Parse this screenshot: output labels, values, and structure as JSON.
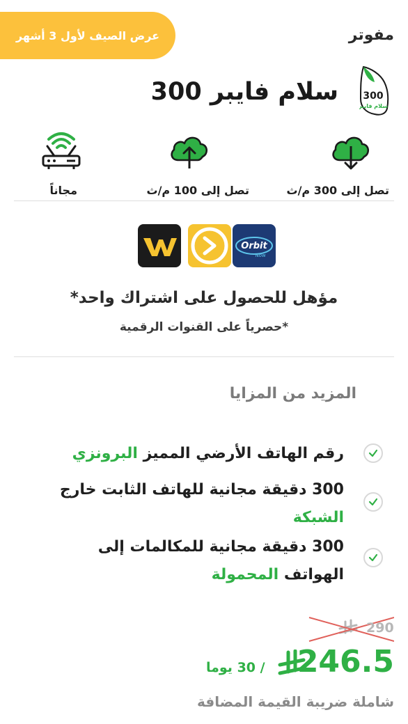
{
  "promo": {
    "label": "عرض الصيف لأول 3 أشهر"
  },
  "plan": {
    "tag": "مفوتر",
    "badge_number": "300",
    "badge_text": "سلام فايبر",
    "name": "سلام فايبر 300"
  },
  "features": [
    {
      "icon": "cloud-download-icon",
      "label": "تصل إلى 300 م/ث"
    },
    {
      "icon": "cloud-upload-icon",
      "label": "تصل إلى 100 م/ث"
    },
    {
      "icon": "wifi-router-icon",
      "label": "مجاناً"
    }
  ],
  "subscriptions": {
    "logos": [
      {
        "name": "orbit-now-logo",
        "text": "Orbit",
        "subtext": "Now",
        "color": "#1d3a74"
      },
      {
        "name": "play-logo",
        "color": "#f6c330"
      },
      {
        "name": "w-logo",
        "color": "#1b1b1b"
      }
    ],
    "eligible": "مؤهل للحصول على اشتراك واحد*",
    "note": "*حصرياً على القنوات الرقمية"
  },
  "more_benefits": {
    "title": "المزيد من المزايا",
    "items": [
      {
        "text": "رقم الهاتف الأرضي المميز ",
        "highlight": "البرونزي",
        "rest": ""
      },
      {
        "text": "300 دقيقة مجانية للهاتف الثابت خارج ",
        "highlight": "الشبكة",
        "rest": ""
      },
      {
        "text": "300 دقيقة مجانية للمكالمات إلى الهواتف ",
        "highlight": "المحمولة",
        "rest": ""
      }
    ]
  },
  "pricing": {
    "old_price": "290",
    "price": "246.5",
    "period": "/ 30 يوما",
    "vat_note": "شاملة ضريبة القيمة المضافة"
  },
  "colors": {
    "brand_green": "#2fb045",
    "promo_yellow": "#fcc13c",
    "strike_red": "#e0605a"
  }
}
